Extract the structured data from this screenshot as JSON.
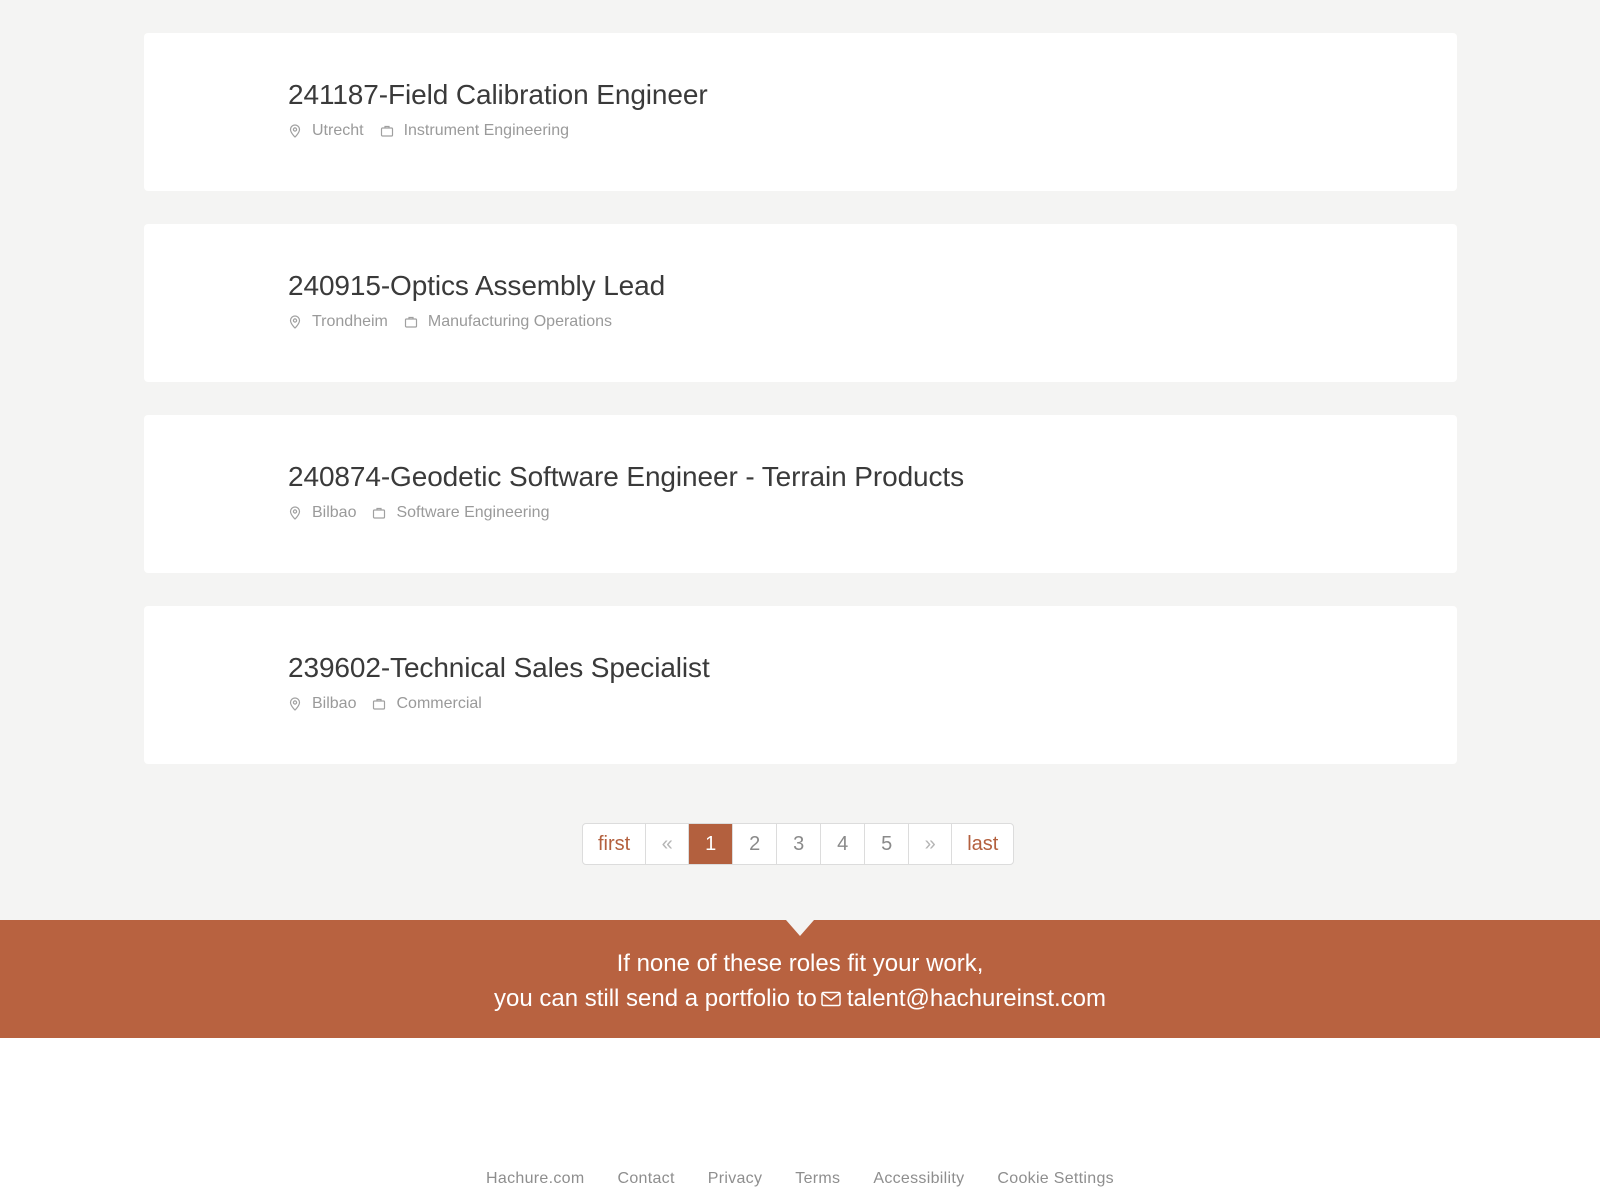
{
  "jobs": [
    {
      "title": "241187-Field Calibration Engineer",
      "location": "Utrecht",
      "department": "Instrument Engineering"
    },
    {
      "title": "240915-Optics Assembly Lead",
      "location": "Trondheim",
      "department": "Manufacturing Operations"
    },
    {
      "title": "240874-Geodetic Software Engineer - Terrain Products",
      "location": "Bilbao",
      "department": "Software Engineering"
    },
    {
      "title": "239602-Technical Sales Specialist",
      "location": "Bilbao",
      "department": "Commercial"
    }
  ],
  "pagination": {
    "first": "first",
    "prev": "«",
    "pages": [
      "1",
      "2",
      "3",
      "4",
      "5"
    ],
    "current": "1",
    "next": "»",
    "last": "last"
  },
  "banner": {
    "line1": "If none of these roles fit your work,",
    "line2": "you can still send a portfolio to",
    "email": "talent@hachureinst.com"
  },
  "footer": {
    "links": [
      "Hachure.com",
      "Contact",
      "Privacy",
      "Terms",
      "Accessibility",
      "Cookie Settings"
    ]
  },
  "colors": {
    "accent": "#b86240",
    "page_bg": "#f4f4f3",
    "card_bg": "#ffffff"
  },
  "icons": {
    "location": "map-pin-icon",
    "department": "briefcase-icon",
    "email": "mail-icon"
  }
}
